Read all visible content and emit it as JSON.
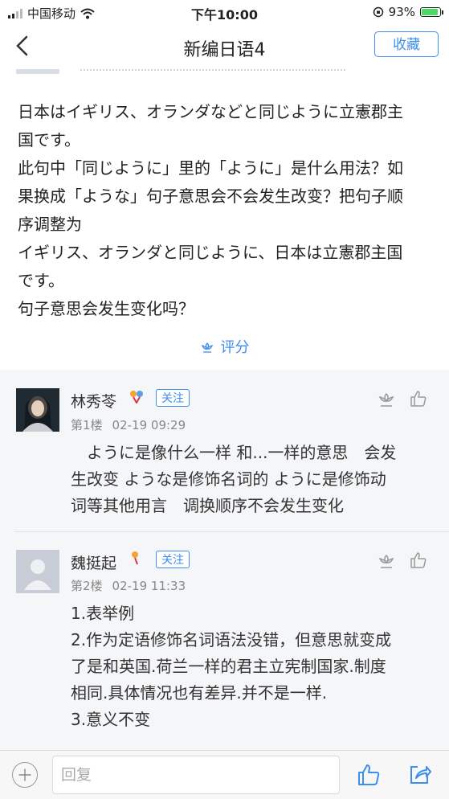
{
  "status_bar": {
    "carrier": "中国移动",
    "time": "下午10:00",
    "battery": "93%",
    "battery_level": 0.93
  },
  "nav": {
    "title": "新编日语4",
    "collect_label": "收藏"
  },
  "post": {
    "lines": [
      "日本はイギリス、オランダなどと同じように立憲郡主",
      "国です。",
      "此句中「同じように」里的「ように」是什么用法？如",
      "果换成「ような」句子意思会不会发生改变？把句子顺",
      "序调整为",
      "イギリス、オランダと同じように、日本は立憲郡主国",
      "です。",
      "句子意思会发生变化吗？"
    ],
    "rate_label": "评分"
  },
  "replies": [
    {
      "name": "林秀苓",
      "follow_label": "关注",
      "floor": "第1楼",
      "time": "02-19 09:29",
      "lines": [
        "　ように是像什么一样 和...一样的意思　会发",
        "生改变 ような是修饰名词的 ように是修饰动",
        "词等其他用言　调换顺序不会发生变化"
      ]
    },
    {
      "name": "魏挺起",
      "follow_label": "关注",
      "floor": "第2楼",
      "time": "02-19 11:33",
      "lines": [
        "1.表举例",
        "2.作为定语修饰名词语法没错，但意思就变成",
        "了是和英国.荷兰一样的君主立宪制国家.制度",
        "相同.具体情况也有差异.并不是一样.",
        "3.意义不变"
      ]
    }
  ],
  "bottom": {
    "reply_placeholder": "回复"
  }
}
